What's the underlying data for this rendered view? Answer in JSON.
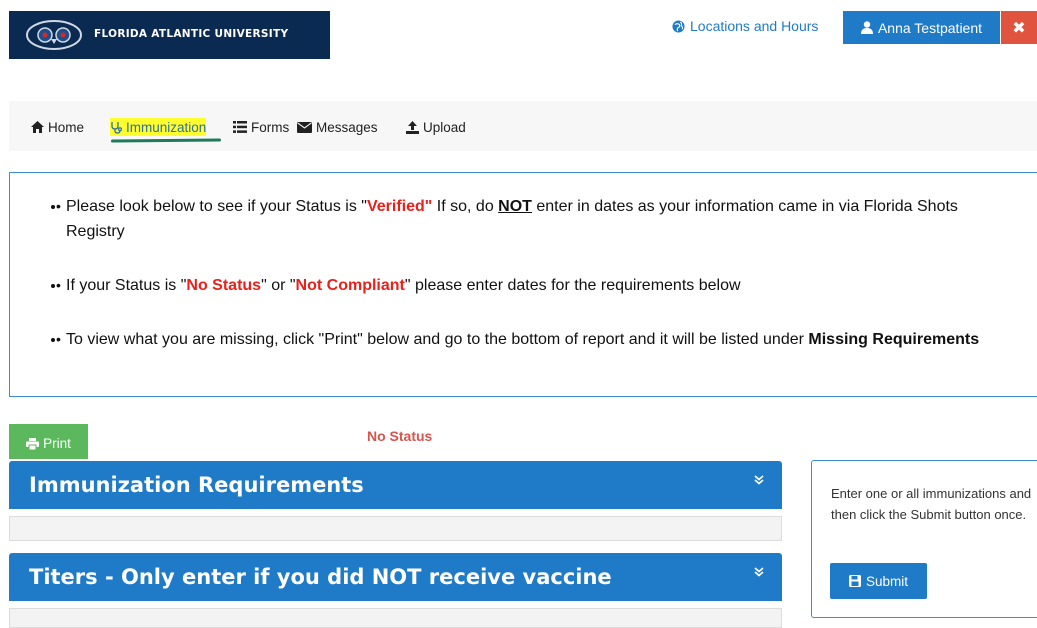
{
  "header": {
    "university_name": "FLORIDA ATLANTIC UNIVERSITY",
    "locations_label": "Locations and Hours",
    "user_name": "Anna Testpatient",
    "close_symbol": "✖"
  },
  "nav": {
    "items": [
      {
        "label": "Home",
        "icon": "home-icon"
      },
      {
        "label": "Immunization",
        "icon": "stethoscope-icon",
        "highlighted": true
      },
      {
        "label": "Forms",
        "icon": "list-icon"
      },
      {
        "label": "Messages",
        "icon": "envelope-icon"
      },
      {
        "label": "Upload",
        "icon": "upload-icon"
      }
    ]
  },
  "instructions": {
    "b1_pre": "Please look below to see if your Status is \"",
    "b1_verified": "Verified\"",
    "b1_mid": " If so, do ",
    "b1_not": "NOT",
    "b1_post": " enter in dates as your information came in via Florida Shots Registry",
    "b2_pre": "If your Status is \"",
    "b2_nostatus": "No Status",
    "b2_mid": "\" or \"",
    "b2_notcompliant": "Not Compliant",
    "b2_post": "\" please enter dates for the requirements below",
    "b3_pre": "To view what you are missing, click \"Print\" below and go to the bottom of report and it will be listed under ",
    "b3_bold": "Missing Requirements"
  },
  "toolbar": {
    "print_label": "Print",
    "status_text": "No Status"
  },
  "panels": [
    {
      "title": "Immunization Requirements"
    },
    {
      "title": "Titers - Only enter if you did NOT receive vaccine"
    }
  ],
  "side": {
    "text": "Enter one or all immunizations and then click the Submit button once.",
    "submit_label": "Submit"
  },
  "colors": {
    "brand_navy": "#0b2a52",
    "primary_blue": "#1f7bc8",
    "success_green": "#5cb85c",
    "danger_red": "#e0533f",
    "status_red": "#d9534f",
    "highlight_yellow": "#ffff2e"
  }
}
